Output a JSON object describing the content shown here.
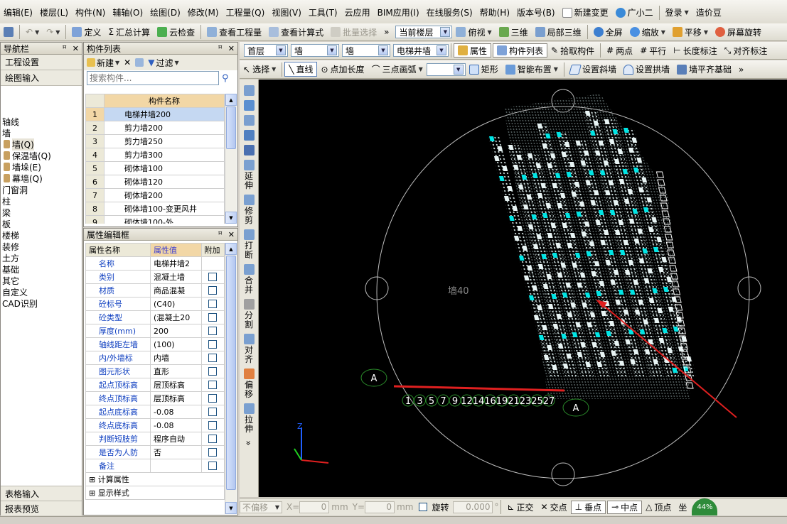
{
  "menu": [
    "编辑(E)",
    "楼层(L)",
    "构件(N)",
    "辅轴(O)",
    "绘图(D)",
    "修改(M)",
    "工程量(Q)",
    "视图(V)",
    "工具(T)",
    "云应用",
    "BIM应用(I)",
    "在线服务(S)",
    "帮助(H)",
    "版本号(B)"
  ],
  "menu_right": {
    "new_change": "新建变更",
    "assistant": "广小二",
    "login": "登录",
    "price": "造价豆"
  },
  "toolbar1": {
    "define": "定义",
    "sum_calc": "汇总计算",
    "cloud_check": "云检查",
    "view_qty": "查看工程量",
    "view_formula": "查看计算式",
    "batch_select": "批量选择",
    "floor_scope": "当前楼层",
    "view_mode": "俯视",
    "threeD": "三维",
    "local3d": "局部三维",
    "fullscreen": "全屏",
    "zoom": "缩放",
    "pan": "平移",
    "screen_rotate": "屏幕旋转"
  },
  "toolbar2": {
    "floor": "首层",
    "category": "墙",
    "type": "墙",
    "component": "电梯井墙",
    "properties": "属性",
    "comp_list": "构件列表",
    "pick": "拾取构件",
    "two_point": "两点",
    "parallel": "平行",
    "length_dim": "长度标注",
    "align_dim": "对齐标注"
  },
  "toolbar3": {
    "select": "选择",
    "line": "直线",
    "point_len": "点加长度",
    "arc3": "三点画弧",
    "rect": "矩形",
    "smart": "智能布置",
    "slope_wall": "设置斜墙",
    "arch_wall": "设置拱墙",
    "flat_base": "墙平齐基础"
  },
  "nav": {
    "title": "导航栏",
    "project_settings": "工程设置",
    "draw_input": "绘图输入",
    "tree": [
      "轴线",
      "墙",
      "墙(Q)",
      "保温墙(Q)",
      "墙垛(E)",
      "幕墙(Q)",
      "门窗洞",
      "柱",
      "梁",
      "板",
      "楼梯",
      "装修",
      "土方",
      "基础",
      "其它",
      "自定义",
      "CAD识别"
    ],
    "table_input": "表格输入",
    "report_preview": "报表预览"
  },
  "comp_list": {
    "title": "构件列表",
    "new": "新建",
    "filter": "过滤",
    "search_placeholder": "搜索构件...",
    "col_name": "构件名称",
    "rows": [
      {
        "no": "1",
        "name": "电梯井墙200"
      },
      {
        "no": "2",
        "name": "剪力墙200"
      },
      {
        "no": "3",
        "name": "剪力墙250"
      },
      {
        "no": "4",
        "name": "剪力墙300"
      },
      {
        "no": "5",
        "name": "砌体墙100"
      },
      {
        "no": "6",
        "name": "砌体墙120"
      },
      {
        "no": "7",
        "name": "砌体墙200"
      },
      {
        "no": "8",
        "name": "砌体墙100-变更风井"
      },
      {
        "no": "9",
        "name": "砌体墙100-外"
      }
    ]
  },
  "props": {
    "title": "属性编辑框",
    "col_name": "属性名称",
    "col_value": "属性值",
    "col_extra": "附加",
    "rows": [
      {
        "name": "名称",
        "value": "电梯井墙2"
      },
      {
        "name": "类别",
        "value": "混凝土墙"
      },
      {
        "name": "材质",
        "value": "商品混凝"
      },
      {
        "name": "砼标号",
        "value": "(C40)"
      },
      {
        "name": "砼类型",
        "value": "(混凝土20"
      },
      {
        "name": "厚度(mm)",
        "value": "200"
      },
      {
        "name": "轴线距左墙",
        "value": "(100)"
      },
      {
        "name": "内/外墙标",
        "value": "内墙"
      },
      {
        "name": "图元形状",
        "value": "直形"
      },
      {
        "name": "起点顶标高",
        "value": "层顶标高"
      },
      {
        "name": "终点顶标高",
        "value": "层顶标高"
      },
      {
        "name": "起点底标高",
        "value": "-0.08"
      },
      {
        "name": "终点底标高",
        "value": "-0.08"
      },
      {
        "name": "判断短肢剪",
        "value": "程序自动"
      },
      {
        "name": "是否为人防",
        "value": "否"
      },
      {
        "name": "备注",
        "value": ""
      }
    ],
    "calc_props": "计算属性",
    "display_style": "显示样式"
  },
  "vtools": [
    {
      "icon": "brush-icon",
      "label": ""
    },
    {
      "icon": "copy-icon",
      "label": ""
    },
    {
      "icon": "mirror-icon",
      "label": ""
    },
    {
      "icon": "move-icon",
      "label": ""
    },
    {
      "icon": "rotate-icon",
      "label": ""
    },
    {
      "icon": "extend-icon",
      "label": "延伸"
    },
    {
      "icon": "trim-icon",
      "label": "修剪"
    },
    {
      "icon": "break-icon",
      "label": "打断"
    },
    {
      "icon": "merge-icon",
      "label": "合并"
    },
    {
      "icon": "split-icon",
      "label": "分割"
    },
    {
      "icon": "align-icon",
      "label": "对齐"
    },
    {
      "icon": "offset-icon",
      "label": "偏移"
    },
    {
      "icon": "stretch-icon",
      "label": "拉伸"
    }
  ],
  "canvas": {
    "axis_top": [
      "1",
      "3",
      "5",
      "7",
      "9",
      "12",
      "14",
      "16",
      "19",
      "21",
      "23",
      "25",
      "27"
    ],
    "axis_letter": "A",
    "overlay_label": "墙40"
  },
  "status": {
    "snap": "不偏移",
    "x_label": "X=",
    "x_val": "0",
    "unit": "mm",
    "y_label": "Y=",
    "y_val": "0",
    "rotate": "旋转",
    "rotate_val": "0.000",
    "ortho": "正交",
    "intersect": "交点",
    "perp": "垂点",
    "mid": "中点",
    "vertex": "顶点",
    "half": "坐",
    "pct": "44%"
  },
  "colors": {
    "canvas_bg": "#000000",
    "cyan": "#00e5e5",
    "accent_red": "#e02020",
    "grid_green": "#33aa33"
  }
}
